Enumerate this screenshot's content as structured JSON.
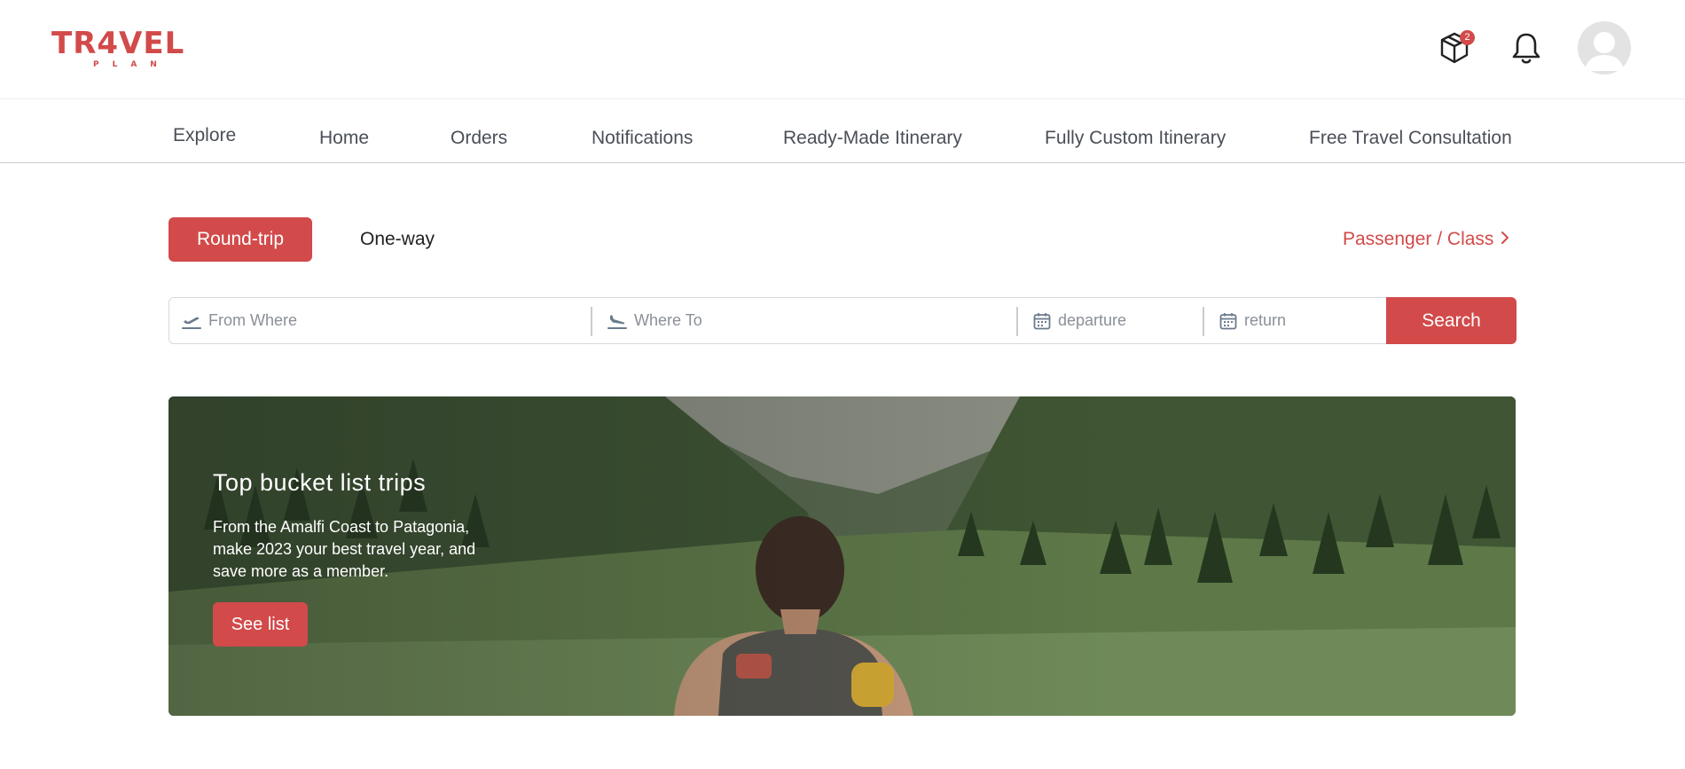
{
  "brand": {
    "logo_main": "TR4VEL",
    "logo_sub": "PLAN",
    "accent_color": "#d24a4a"
  },
  "header": {
    "package_icon": "package-icon",
    "package_badge": "2",
    "bell_icon": "bell-icon",
    "avatar_icon": "user-avatar-icon"
  },
  "nav": {
    "items": [
      {
        "label": "Explore"
      },
      {
        "label": "Home"
      },
      {
        "label": "Orders"
      },
      {
        "label": "Notifications"
      },
      {
        "label": "Ready-Made Itinerary"
      },
      {
        "label": "Fully Custom Itinerary"
      },
      {
        "label": "Free Travel Consultation"
      }
    ],
    "active": "Explore"
  },
  "trip": {
    "round_trip": "Round-trip",
    "one_way": "One-way",
    "selected": "Round-trip",
    "passenger_class": "Passenger / Class"
  },
  "search": {
    "from_placeholder": "From Where",
    "to_placeholder": "Where To",
    "departure_placeholder": "departure",
    "return_placeholder": "return",
    "button": "Search"
  },
  "hero": {
    "title": "Top bucket list trips",
    "text": "From the Amalfi Coast to Patagonia, make 2023 your best travel year, and save more as a member.",
    "button": "See list"
  }
}
